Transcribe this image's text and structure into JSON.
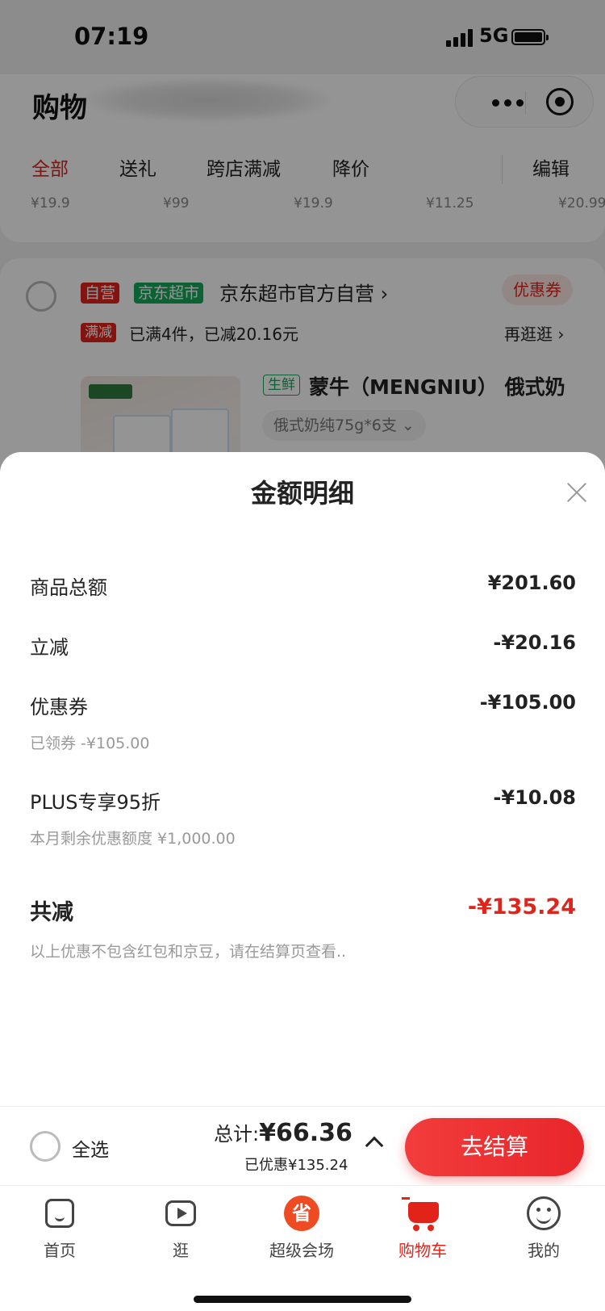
{
  "status_bar": {
    "time": "07:19",
    "network": "5G"
  },
  "header": {
    "title": "购物"
  },
  "tabs": [
    {
      "label": "全部",
      "active": true
    },
    {
      "label": "送礼",
      "active": false
    },
    {
      "label": "跨店满减",
      "active": false
    },
    {
      "label": "降价",
      "active": false
    }
  ],
  "edit_label": "编辑",
  "tab_prices": [
    "¥19.9",
    "¥99",
    "¥19.9",
    "¥11.25",
    "¥20.99"
  ],
  "shop": {
    "tag_self": "自营",
    "tag_super": "京东超市",
    "name": "京东超市官方自营 ›",
    "coupon": "优惠券",
    "promo_tag": "满减",
    "promo_text": "已满4件，已减20.16元",
    "more": "再逛逛 ›"
  },
  "product": {
    "fresh_tag": "生鲜",
    "name": "蒙牛（MENGNIU） 俄式奶",
    "spec": "俄式奶纯75g*6支 ⌄"
  },
  "sheet": {
    "title": "金额明细",
    "rows": [
      {
        "label": "商品总额",
        "value": "¥201.60"
      },
      {
        "label": "立减",
        "value": "-¥20.16"
      },
      {
        "label": "优惠券",
        "value": "-¥105.00",
        "sub": "已领券 -¥105.00"
      },
      {
        "label": "PLUS专享95折",
        "value": "-¥10.08",
        "sub": "本月剩余优惠额度 ¥1,000.00"
      }
    ],
    "total_label": "共减",
    "total_value": "-¥135.24",
    "note": "以上优惠不包含红包和京豆，请在结算页查看.."
  },
  "checkout": {
    "select_all": "全选",
    "total_prefix": "总计:",
    "total": "¥66.36",
    "saved": "已优惠¥135.24",
    "button": "去结算"
  },
  "tabbar": [
    {
      "label": "首页",
      "icon": "home-icon"
    },
    {
      "label": "逛",
      "icon": "video-icon"
    },
    {
      "label": "超级会场",
      "icon": "super-venue-icon",
      "glyph": "省"
    },
    {
      "label": "购物车",
      "icon": "cart-icon",
      "active": true
    },
    {
      "label": "我的",
      "icon": "profile-icon"
    }
  ],
  "colors": {
    "accent": "#e2231a",
    "green": "#18a95c"
  }
}
